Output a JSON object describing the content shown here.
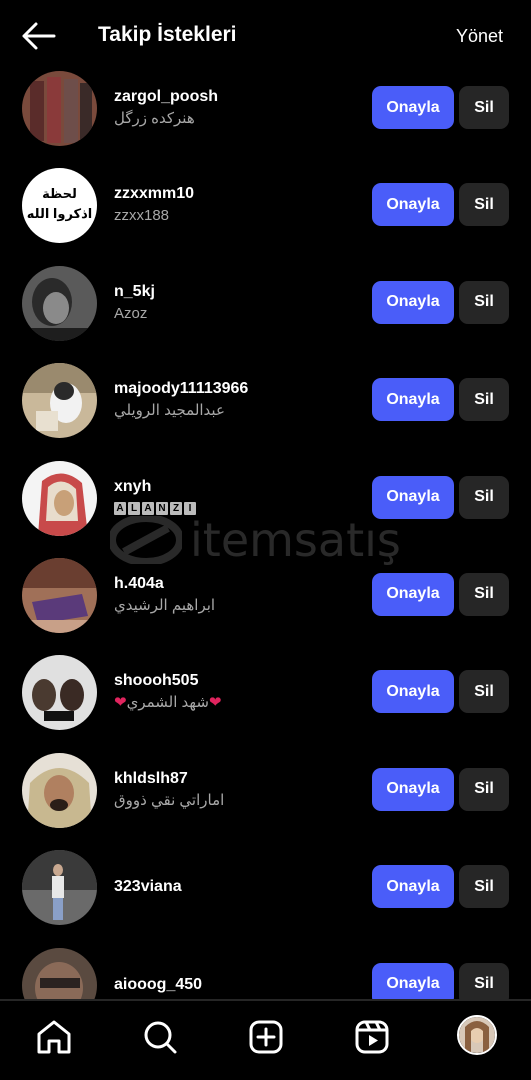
{
  "header": {
    "title": "Takip İstekleri",
    "manage": "Yönet"
  },
  "buttons": {
    "confirm": "Onayla",
    "delete": "Sil"
  },
  "requests": [
    {
      "username": "zargol_poosh",
      "display_name": "هنرکده زرگل"
    },
    {
      "username": "zzxxmm10",
      "display_name": "zzxx188"
    },
    {
      "username": "n_5kj",
      "display_name": "Azoz"
    },
    {
      "username": "majoody11113966",
      "display_name": "عبدالمجيد الرويلي"
    },
    {
      "username": "xnyh",
      "display_name": "ALANZI"
    },
    {
      "username": "h.404a",
      "display_name": "ابراهيم الرشيدي"
    },
    {
      "username": "shoooh505",
      "display_name": "شهد الشمري"
    },
    {
      "username": "khldslh87",
      "display_name": "اماراتي نقي ذووق"
    },
    {
      "username": "323viana",
      "display_name": ""
    },
    {
      "username": "aiooog_450",
      "display_name": ""
    }
  ],
  "avatar_2_text": {
    "line1": "لحظة",
    "line2": "اذكروا الله"
  },
  "watermark": "itemsatış",
  "icons": {
    "back": "arrow-left-icon",
    "nav": [
      "home-icon",
      "search-icon",
      "create-icon",
      "reels-icon",
      "profile-avatar"
    ]
  },
  "colors": {
    "accent": "#4a5df9",
    "secondary_button": "#262626",
    "muted_text": "#a8a8a8",
    "background": "#000000"
  }
}
